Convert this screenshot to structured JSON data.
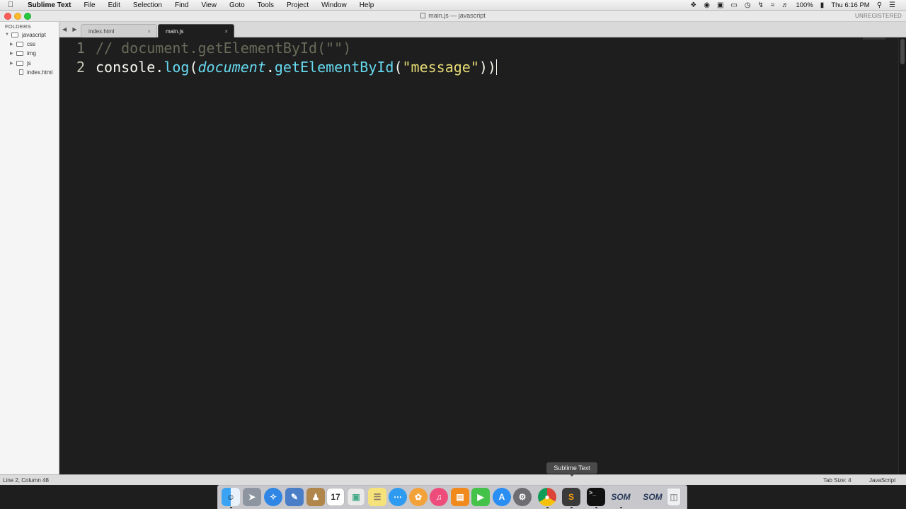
{
  "menubar": {
    "apple_icon": "apple-logo-icon",
    "app_name": "Sublime Text",
    "items": [
      "File",
      "Edit",
      "Selection",
      "Find",
      "View",
      "Goto",
      "Tools",
      "Project",
      "Window",
      "Help"
    ],
    "status_icons": [
      "dropbox-icon",
      "creative-cloud-icon",
      "screen-icon",
      "airplay-icon",
      "time-machine-icon",
      "bluetooth-icon",
      "wifi-icon",
      "volume-icon"
    ],
    "battery": "100%",
    "clock": "Thu 6:16 PM"
  },
  "window": {
    "title": "main.js — javascript",
    "unregistered": "UNREGISTERED"
  },
  "sidebar": {
    "folders_label": "FOLDERS",
    "root": "javascript",
    "items": [
      {
        "label": "css",
        "type": "folder"
      },
      {
        "label": "img",
        "type": "folder"
      },
      {
        "label": "js",
        "type": "folder"
      },
      {
        "label": "index.html",
        "type": "file"
      }
    ]
  },
  "tabs": [
    {
      "label": "index.html",
      "active": false
    },
    {
      "label": "main.js",
      "active": true
    }
  ],
  "tab_close": "×",
  "tab_nav": "◀ ▶",
  "editor": {
    "lines": [
      {
        "number": "1",
        "comment": "// document.getElementById(\"\")"
      },
      {
        "number": "2",
        "console": "console",
        "dot1": ".",
        "log": "log",
        "open1": "(",
        "document": "document",
        "dot2": ".",
        "method": "getElementById",
        "open2": "(",
        "string": "\"message\"",
        "close": "))"
      }
    ]
  },
  "statusbar": {
    "position": "Line 2, Column 48",
    "tab_size": "Tab Size: 4",
    "syntax": "JavaScript"
  },
  "dock": {
    "tooltip": "Sublime Text",
    "calendar_day": "17",
    "som_label": "SOM"
  }
}
